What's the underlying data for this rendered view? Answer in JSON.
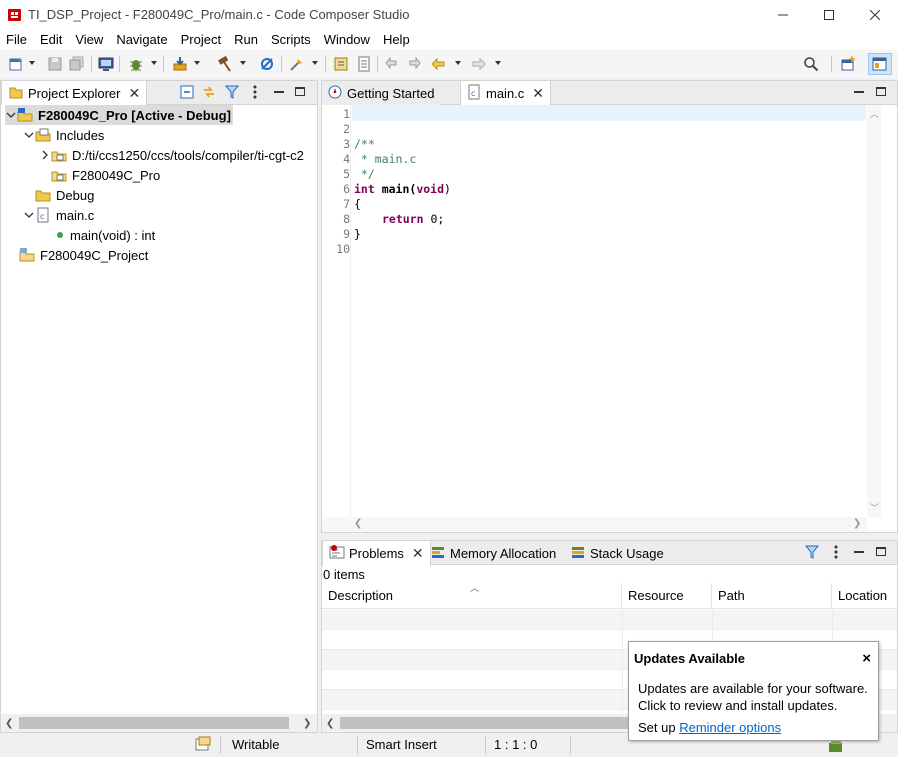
{
  "window": {
    "title": "TI_DSP_Project - F280049C_Pro/main.c - Code Composer Studio",
    "minimize_label": "—",
    "maximize_label": "☐",
    "close_label": "✕"
  },
  "menubar": {
    "items": [
      "File",
      "Edit",
      "View",
      "Navigate",
      "Project",
      "Run",
      "Scripts",
      "Window",
      "Help"
    ]
  },
  "project_explorer": {
    "tab_label": "Project Explorer",
    "tree": [
      {
        "label": "F280049C_Pro  [Active - Debug]",
        "expanded": true
      },
      {
        "label": "Includes",
        "expanded": true
      },
      {
        "label": "D:/ti/ccs1250/ccs/tools/compiler/ti-cgt-c2",
        "expanded": false
      },
      {
        "label": "F280049C_Pro"
      },
      {
        "label": "Debug"
      },
      {
        "label": "main.c",
        "expanded": true
      },
      {
        "label": "main(void) : int"
      },
      {
        "label": "F280049C_Project"
      }
    ]
  },
  "editor": {
    "tabs": [
      {
        "label": "Getting Started",
        "active": false
      },
      {
        "label": "main.c",
        "active": true
      }
    ],
    "line_numbers": [
      "1",
      "2",
      "3",
      "4",
      "5",
      "6",
      "7",
      "8",
      "9",
      "10"
    ],
    "code": {
      "l3": "/**",
      "l4": " * main.c",
      "l5": " */",
      "l6_kw1": "int",
      "l6_fn": " main(",
      "l6_kw2": "void",
      "l6_end": ")",
      "l7": "{",
      "l8_kw": "return",
      "l8_end": " 0;",
      "l9": "}"
    }
  },
  "problems": {
    "tabs": [
      "Problems",
      "Memory Allocation",
      "Stack Usage"
    ],
    "item_count": "0 items",
    "columns": [
      "Description",
      "Resource",
      "Path",
      "Location"
    ]
  },
  "statusbar": {
    "writable": "Writable",
    "insert_mode": "Smart Insert",
    "position": "1 : 1 : 0"
  },
  "notification": {
    "title": "Updates Available",
    "close": "×",
    "line1": "Updates are available for your software.",
    "line2": "Click to review and install updates.",
    "line3_prefix": "Set up ",
    "link": "Reminder options"
  },
  "colors": {
    "accent_blue": "#1e6fc5",
    "comment_green": "#3f7f5f",
    "keyword_purple": "#7f0055",
    "link_blue": "#0066cc",
    "ti_red": "#cc0000"
  }
}
